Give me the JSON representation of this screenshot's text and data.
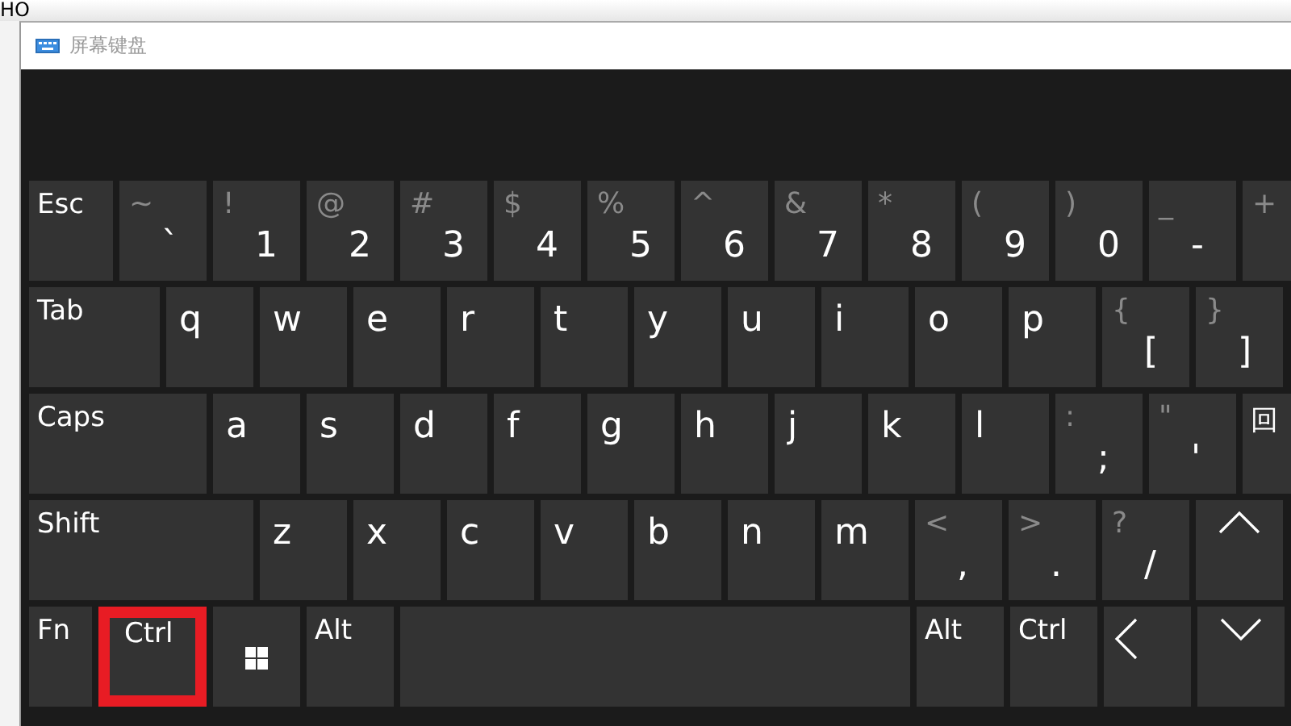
{
  "background": {
    "text": "HO"
  },
  "window": {
    "title": "屏幕键盘"
  },
  "keyboard": {
    "rows": [
      {
        "keys": [
          {
            "kind": "label",
            "main": "Esc",
            "highlighted": false
          },
          {
            "kind": "dual",
            "shift": "~",
            "main": "`",
            "highlighted": false
          },
          {
            "kind": "dual",
            "shift": "!",
            "main": "1",
            "highlighted": false
          },
          {
            "kind": "dual",
            "shift": "@",
            "main": "2",
            "highlighted": false
          },
          {
            "kind": "dual",
            "shift": "#",
            "main": "3",
            "highlighted": false
          },
          {
            "kind": "dual",
            "shift": "$",
            "main": "4",
            "highlighted": false
          },
          {
            "kind": "dual",
            "shift": "%",
            "main": "5",
            "highlighted": false
          },
          {
            "kind": "dual",
            "shift": "^",
            "main": "6",
            "highlighted": false
          },
          {
            "kind": "dual",
            "shift": "&",
            "main": "7",
            "highlighted": false
          },
          {
            "kind": "dual",
            "shift": "*",
            "main": "8",
            "highlighted": false
          },
          {
            "kind": "dual",
            "shift": "(",
            "main": "9",
            "highlighted": false
          },
          {
            "kind": "dual",
            "shift": ")",
            "main": "0",
            "highlighted": false
          },
          {
            "kind": "dual",
            "shift": "_",
            "main": "-",
            "highlighted": false
          },
          {
            "kind": "dual",
            "shift": "+",
            "highlighted": false
          }
        ]
      },
      {
        "keys": [
          {
            "kind": "label",
            "main": "Tab",
            "highlighted": false
          },
          {
            "kind": "letter",
            "main": "q",
            "highlighted": false
          },
          {
            "kind": "letter",
            "main": "w",
            "highlighted": false
          },
          {
            "kind": "letter",
            "main": "e",
            "highlighted": false
          },
          {
            "kind": "letter",
            "main": "r",
            "highlighted": false
          },
          {
            "kind": "letter",
            "main": "t",
            "highlighted": false
          },
          {
            "kind": "letter",
            "main": "y",
            "highlighted": false
          },
          {
            "kind": "letter",
            "main": "u",
            "highlighted": false
          },
          {
            "kind": "letter",
            "main": "i",
            "highlighted": false
          },
          {
            "kind": "letter",
            "main": "o",
            "highlighted": false
          },
          {
            "kind": "letter",
            "main": "p",
            "highlighted": false
          },
          {
            "kind": "dual",
            "shift": "{",
            "main": "[",
            "highlighted": false
          },
          {
            "kind": "dual",
            "shift": "}",
            "main": "]",
            "highlighted": false
          }
        ]
      },
      {
        "keys": [
          {
            "kind": "label",
            "main": "Caps",
            "highlighted": false
          },
          {
            "kind": "letter",
            "main": "a",
            "highlighted": false
          },
          {
            "kind": "letter",
            "main": "s",
            "highlighted": false
          },
          {
            "kind": "letter",
            "main": "d",
            "highlighted": false
          },
          {
            "kind": "letter",
            "main": "f",
            "highlighted": false
          },
          {
            "kind": "letter",
            "main": "g",
            "highlighted": false
          },
          {
            "kind": "letter",
            "main": "h",
            "highlighted": false
          },
          {
            "kind": "letter",
            "main": "j",
            "highlighted": false
          },
          {
            "kind": "letter",
            "main": "k",
            "highlighted": false
          },
          {
            "kind": "letter",
            "main": "l",
            "highlighted": false
          },
          {
            "kind": "dual",
            "shift": ":",
            "main": ";",
            "highlighted": false
          },
          {
            "kind": "dual",
            "shift": "\"",
            "main": "'",
            "highlighted": false
          },
          {
            "kind": "label",
            "main": "回",
            "highlighted": false
          }
        ]
      },
      {
        "keys": [
          {
            "kind": "label",
            "main": "Shift",
            "highlighted": false
          },
          {
            "kind": "letter",
            "main": "z",
            "highlighted": false
          },
          {
            "kind": "letter",
            "main": "x",
            "highlighted": false
          },
          {
            "kind": "letter",
            "main": "c",
            "highlighted": false
          },
          {
            "kind": "letter",
            "main": "v",
            "highlighted": false
          },
          {
            "kind": "letter",
            "main": "b",
            "highlighted": false
          },
          {
            "kind": "letter",
            "main": "n",
            "highlighted": false
          },
          {
            "kind": "letter",
            "main": "m",
            "highlighted": false
          },
          {
            "kind": "dual",
            "shift": "<",
            "main": ",",
            "highlighted": false
          },
          {
            "kind": "dual",
            "shift": ">",
            "main": ".",
            "highlighted": false
          },
          {
            "kind": "dual",
            "shift": "?",
            "main": "/",
            "highlighted": false
          },
          {
            "kind": "arrow-up",
            "highlighted": false
          }
        ]
      },
      {
        "keys": [
          {
            "kind": "label",
            "main": "Fn",
            "highlighted": false
          },
          {
            "kind": "label",
            "main": "Ctrl",
            "highlighted": true
          },
          {
            "kind": "windows",
            "highlighted": false
          },
          {
            "kind": "label",
            "main": "Alt",
            "highlighted": false
          },
          {
            "kind": "space",
            "highlighted": false
          },
          {
            "kind": "label",
            "main": "Alt",
            "highlighted": false
          },
          {
            "kind": "label",
            "main": "Ctrl",
            "highlighted": false
          },
          {
            "kind": "arrow-left",
            "highlighted": false
          },
          {
            "kind": "arrow-down",
            "highlighted": false
          }
        ]
      }
    ]
  }
}
